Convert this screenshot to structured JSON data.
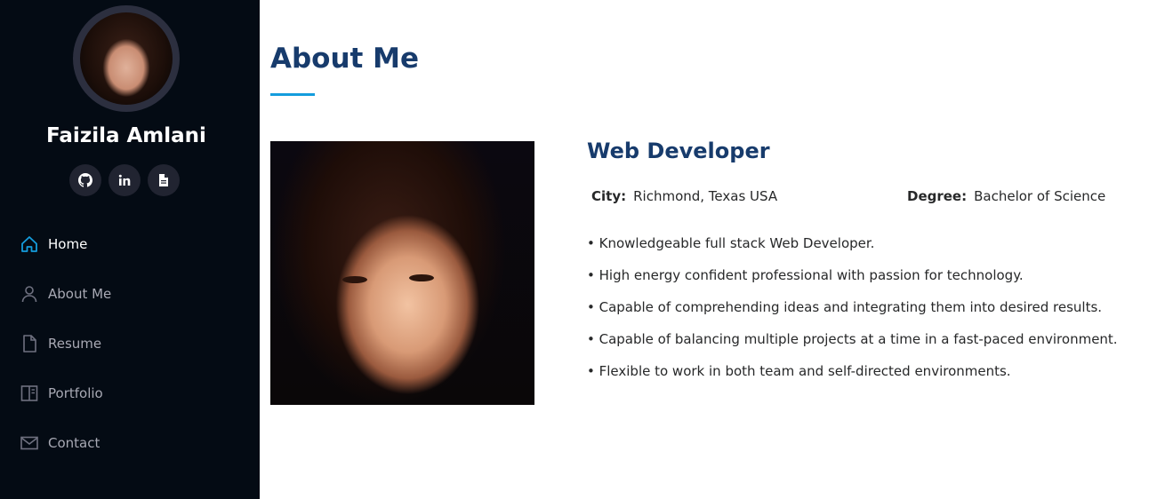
{
  "profile": {
    "name": "Faizila Amlani",
    "social": [
      {
        "icon": "github-icon"
      },
      {
        "icon": "linkedin-icon"
      },
      {
        "icon": "resume-file-icon"
      }
    ]
  },
  "nav": {
    "items": [
      {
        "label": "Home",
        "icon": "home-icon",
        "active": true
      },
      {
        "label": "About Me",
        "icon": "person-icon",
        "active": false
      },
      {
        "label": "Resume",
        "icon": "file-icon",
        "active": false
      },
      {
        "label": "Portfolio",
        "icon": "book-icon",
        "active": false
      },
      {
        "label": "Contact",
        "icon": "envelope-icon",
        "active": false
      }
    ]
  },
  "about": {
    "title": "About Me",
    "role": "Web Developer",
    "city_label": "City:",
    "city": "Richmond, Texas USA",
    "degree_label": "Degree:",
    "degree": "Bachelor of Science",
    "bullets": [
      "• Knowledgeable full stack Web Developer.",
      "• High energy confident professional with passion for technology.",
      "• Capable of comprehending ideas and integrating them into desired results.",
      "• Capable of balancing multiple projects at a time in a fast-paced environment.",
      "• Flexible to work in both team and self-directed environments."
    ]
  },
  "colors": {
    "sidebar_bg": "#040b14",
    "accent": "#149ddd",
    "heading": "#173b6c",
    "nav_text": "#a8a9b4"
  }
}
